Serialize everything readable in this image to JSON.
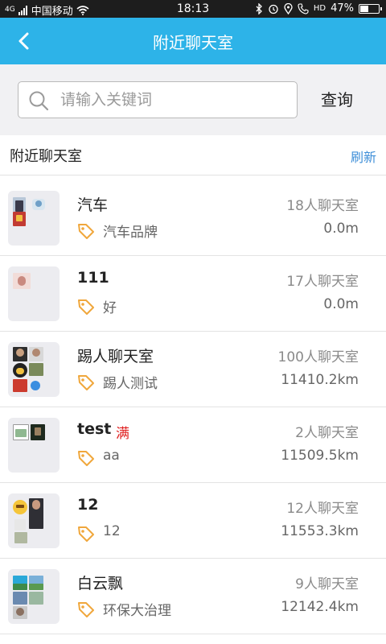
{
  "status_bar": {
    "network": "4G",
    "carrier": "中国移动",
    "time": "18:13",
    "hd_label": "HD",
    "battery": "47%",
    "battery_level": 0.47
  },
  "header": {
    "title": "附近聊天室",
    "back_icon": "back-arrow-icon"
  },
  "search": {
    "placeholder": "请输入关键词",
    "value": "",
    "query_label": "查询"
  },
  "section": {
    "title": "附近聊天室",
    "refresh_label": "刷新"
  },
  "colors": {
    "header_bg": "#2db3e8",
    "refresh": "#3f8fd8",
    "full_badge": "#e02020",
    "tag_icon": "#f0a73c"
  },
  "rooms": [
    {
      "name": "汽车",
      "bold": false,
      "full_label": "",
      "desc": "汽车品牌",
      "count": "18人聊天室",
      "distance": "0.0m"
    },
    {
      "name": "111",
      "bold": true,
      "full_label": "",
      "desc": "好",
      "count": "17人聊天室",
      "distance": "0.0m"
    },
    {
      "name": "踢人聊天室",
      "bold": false,
      "full_label": "",
      "desc": "踢人测试",
      "count": "100人聊天室",
      "distance": "11410.2km"
    },
    {
      "name": "test",
      "bold": true,
      "full_label": "满",
      "desc": "aa",
      "count": "2人聊天室",
      "distance": "11509.5km"
    },
    {
      "name": "12",
      "bold": true,
      "full_label": "",
      "desc": "12",
      "count": "12人聊天室",
      "distance": "11553.3km"
    },
    {
      "name": "白云飘",
      "bold": false,
      "full_label": "",
      "desc": "环保大治理",
      "count": "9人聊天室",
      "distance": "12142.4km"
    }
  ]
}
